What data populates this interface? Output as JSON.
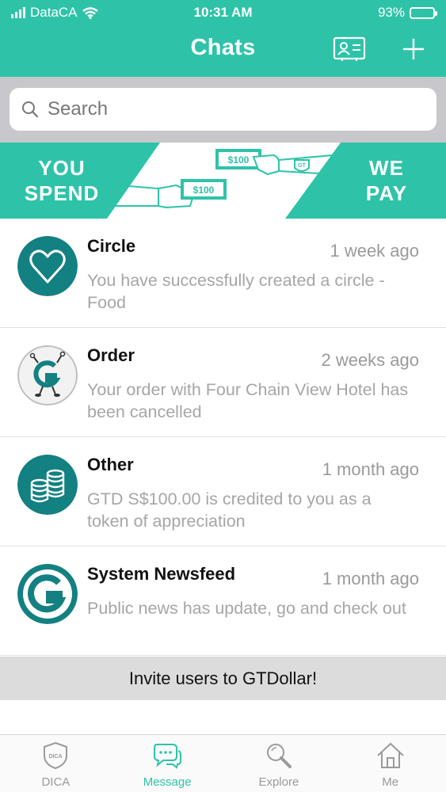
{
  "status_bar": {
    "carrier": "DataCA",
    "time": "10:31 AM",
    "battery": "93%"
  },
  "header": {
    "title": "Chats"
  },
  "search": {
    "placeholder": "Search"
  },
  "banner": {
    "left_line1": "YOU",
    "left_line2": "SPEND",
    "right_line1": "WE",
    "right_line2": "PAY",
    "note_amount_top": "$100",
    "note_amount_bottom": "$100",
    "shield_text": "GT"
  },
  "chats": [
    {
      "name": "Circle",
      "time": "1 week ago",
      "message": "You have successfully created a circle - Food"
    },
    {
      "name": "Order",
      "time": "2 weeks ago",
      "message": "Your order with Four Chain View Hotel has been cancelled"
    },
    {
      "name": "Other",
      "time": "1 month ago",
      "message": "GTD S$100.00 is credited to you as a token of appreciation"
    },
    {
      "name": "System Newsfeed",
      "time": "1 month ago",
      "message": "Public news has update, go and check out"
    }
  ],
  "invite": {
    "label": "Invite users to GTDollar!"
  },
  "tabs": [
    {
      "label": "DICA",
      "icon_text": "DICA",
      "active": false
    },
    {
      "label": "Message",
      "active": true
    },
    {
      "label": "Explore",
      "active": false
    },
    {
      "label": "Me",
      "active": false
    }
  ],
  "colors": {
    "accent": "#2ec3a8",
    "avatar_bg": "#138081",
    "muted": "#a6a6a6"
  }
}
